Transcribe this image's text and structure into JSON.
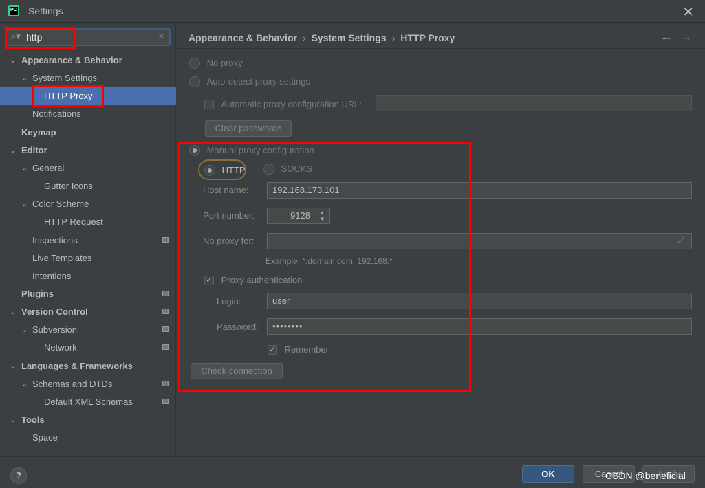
{
  "window": {
    "title": "Settings"
  },
  "search": {
    "value": "http"
  },
  "tree": [
    {
      "label": "Appearance & Behavior",
      "bold": true,
      "expanded": true,
      "indent": 0
    },
    {
      "label": "System Settings",
      "bold": false,
      "expanded": true,
      "indent": 1
    },
    {
      "label": "HTTP Proxy",
      "bold": false,
      "indent": 2,
      "selected": true
    },
    {
      "label": "Notifications",
      "bold": false,
      "indent": 1
    },
    {
      "label": "Keymap",
      "bold": true,
      "indent": 0
    },
    {
      "label": "Editor",
      "bold": true,
      "expanded": true,
      "indent": 0
    },
    {
      "label": "General",
      "bold": false,
      "expanded": true,
      "indent": 1
    },
    {
      "label": "Gutter Icons",
      "bold": false,
      "indent": 2
    },
    {
      "label": "Color Scheme",
      "bold": false,
      "expanded": true,
      "indent": 1
    },
    {
      "label": "HTTP Request",
      "bold": false,
      "indent": 2
    },
    {
      "label": "Inspections",
      "bold": false,
      "indent": 1,
      "project": true
    },
    {
      "label": "Live Templates",
      "bold": false,
      "indent": 1
    },
    {
      "label": "Intentions",
      "bold": false,
      "indent": 1
    },
    {
      "label": "Plugins",
      "bold": true,
      "indent": 0,
      "project": true
    },
    {
      "label": "Version Control",
      "bold": true,
      "expanded": true,
      "indent": 0,
      "project": true
    },
    {
      "label": "Subversion",
      "bold": false,
      "expanded": true,
      "indent": 1,
      "project": true
    },
    {
      "label": "Network",
      "bold": false,
      "indent": 2,
      "project": true
    },
    {
      "label": "Languages & Frameworks",
      "bold": true,
      "expanded": true,
      "indent": 0
    },
    {
      "label": "Schemas and DTDs",
      "bold": false,
      "expanded": true,
      "indent": 1,
      "project": true
    },
    {
      "label": "Default XML Schemas",
      "bold": false,
      "indent": 2,
      "project": true
    },
    {
      "label": "Tools",
      "bold": true,
      "expanded": true,
      "indent": 0
    },
    {
      "label": "Space",
      "bold": false,
      "indent": 1
    }
  ],
  "breadcrumb": {
    "part1": "Appearance & Behavior",
    "part2": "System Settings",
    "part3": "HTTP Proxy",
    "separator": "›"
  },
  "proxy": {
    "no_proxy_label": "No proxy",
    "auto_detect_label": "Auto-detect proxy settings",
    "auto_config_url_label": "Automatic proxy configuration URL:",
    "auto_config_url_value": "",
    "clear_passwords_label": "Clear passwords",
    "manual_label": "Manual proxy configuration",
    "http_label": "HTTP",
    "socks_label": "SOCKS",
    "host_label": "Host name:",
    "host_value": "192.168.173.101",
    "port_label": "Port number:",
    "port_value": "9128",
    "no_proxy_for_label": "No proxy for:",
    "no_proxy_for_value": "",
    "example_text": "Example: *.domain.com, 192.168.*",
    "auth_label": "Proxy authentication",
    "login_label": "Login:",
    "login_value": "user",
    "password_label": "Password:",
    "password_value": "••••••••",
    "remember_label": "Remember",
    "check_connection_label": "Check connection"
  },
  "footer": {
    "help_label": "?",
    "ok_label": "OK",
    "cancel_label": "Cancel",
    "apply_label": "Apply"
  },
  "watermark": "CSDN @beneficial",
  "colors": {
    "selection": "#4b6eaf",
    "ok_button": "#365880",
    "annotation": "#ff0000"
  }
}
